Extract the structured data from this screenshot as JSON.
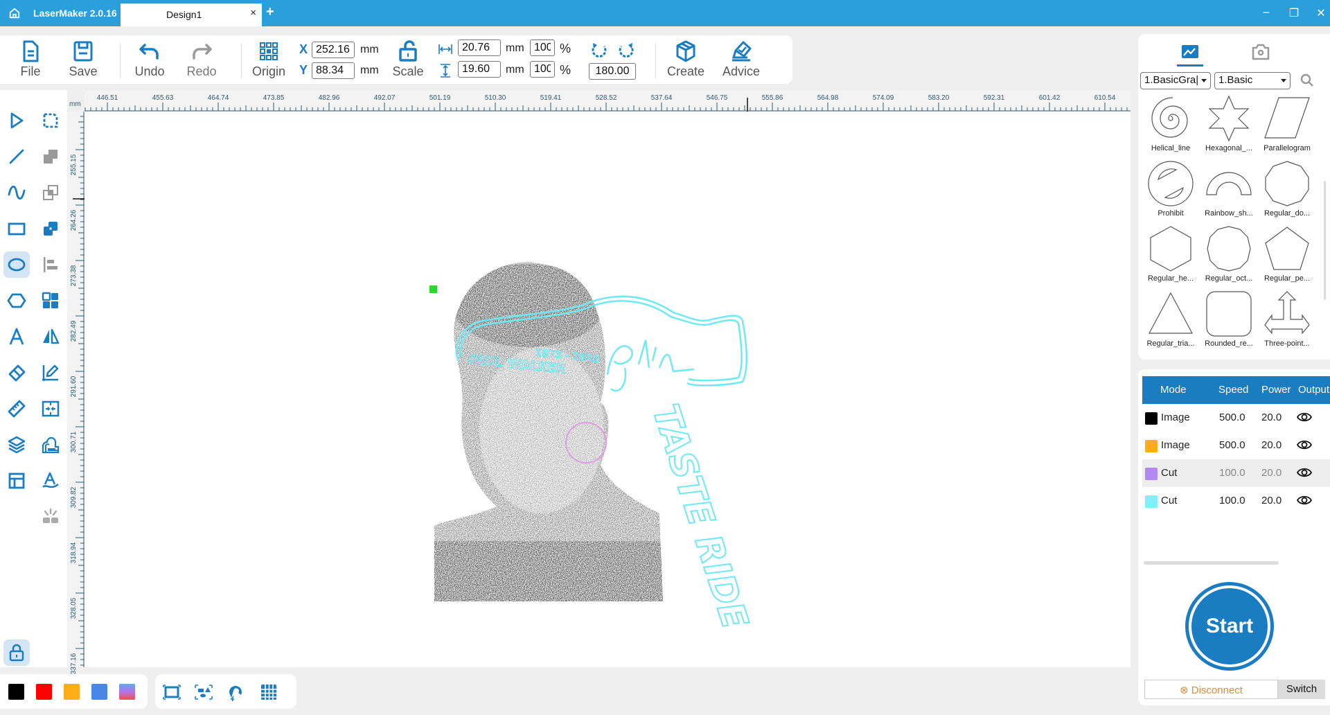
{
  "titlebar": {
    "app_name": "LaserMaker 2.0.16",
    "tab_name": "Design1",
    "tab_close": "×",
    "add_tab": "+",
    "minimize": "–",
    "restore": "❐",
    "close": "✕"
  },
  "toolbar": {
    "file": "File",
    "save": "Save",
    "undo": "Undo",
    "redo": "Redo",
    "origin": "Origin",
    "x_label": "X",
    "y_label": "Y",
    "x_value": "252.16",
    "y_value": "88.34",
    "unit": "mm",
    "scale": "Scale",
    "width_value": "20.76",
    "height_value": "19.60",
    "width_pct": "100",
    "height_pct": "100",
    "pct": "%",
    "rotation_value": "180.00",
    "create": "Create",
    "advice": "Advice"
  },
  "ruler": {
    "unit": "mm",
    "top_ticks": [
      "446.51",
      "455.63",
      "464.74",
      "473.85",
      "482.96",
      "492.07",
      "501.19",
      "510.30",
      "519.41",
      "528.52",
      "537.64",
      "546.75",
      "555.86",
      "564.98",
      "574.09",
      "583.20",
      "592.31",
      "601.42",
      "610.54"
    ],
    "left_ticks": [
      "255.15",
      "264.26",
      "273.38",
      "282.49",
      "291.60",
      "300.71",
      "309.82",
      "318.94",
      "328.05",
      "337.16"
    ]
  },
  "left_tools": [
    {
      "name": "select-tool",
      "icon": "pointer-icon"
    },
    {
      "name": "node-edit-tool",
      "icon": "node-edit-icon"
    },
    {
      "name": "line-tool",
      "icon": "line-icon"
    },
    {
      "name": "union-tool",
      "icon": "union-icon"
    },
    {
      "name": "curve-tool",
      "icon": "curve-icon"
    },
    {
      "name": "subtract-tool",
      "icon": "subtract-icon"
    },
    {
      "name": "rectangle-tool",
      "icon": "rectangle-icon"
    },
    {
      "name": "intersect-tool",
      "icon": "intersect-icon"
    },
    {
      "name": "ellipse-tool",
      "icon": "ellipse-icon",
      "active": true
    },
    {
      "name": "align-tool",
      "icon": "align-icon"
    },
    {
      "name": "polygon-tool",
      "icon": "hexagon-icon"
    },
    {
      "name": "array-tool",
      "icon": "grid-icon"
    },
    {
      "name": "text-tool",
      "icon": "text-icon"
    },
    {
      "name": "mirror-tool",
      "icon": "mirror-icon"
    },
    {
      "name": "eraser-tool",
      "icon": "eraser-icon"
    },
    {
      "name": "measure-edit-tool",
      "icon": "pen-edit-icon"
    },
    {
      "name": "ruler-tool",
      "icon": "ruler-icon"
    },
    {
      "name": "fit-tool",
      "icon": "fit-icon"
    },
    {
      "name": "layers-tool",
      "icon": "layers-icon"
    },
    {
      "name": "offset-tool",
      "icon": "offset-icon"
    },
    {
      "name": "layout-tool",
      "icon": "layout-icon"
    },
    {
      "name": "path-text-tool",
      "icon": "path-text-icon"
    },
    {
      "name": "laser-tool",
      "icon": "laser-icon"
    }
  ],
  "colors": {
    "accent": "#1a7dc2",
    "titlebar": "#2a9fdc",
    "cyan_cut": "#6ee9f5",
    "swatches": [
      "#000000",
      "#ff0000",
      "#ffab1a",
      "#4a86e8",
      "gradient"
    ]
  },
  "right_panel": {
    "tabs": [
      {
        "name": "gallery-tab",
        "icon": "image-icon",
        "active": true
      },
      {
        "name": "camera-tab",
        "icon": "camera-icon",
        "active": false
      }
    ],
    "category_select": "1.BasicGra|",
    "subcategory_select": "1.Basic",
    "shapes": [
      "Helical_line",
      "Hexagonal_...",
      "Parallelogram",
      "Prohibit",
      "Rainbow_sh...",
      "Regular_do...",
      "Regular_he...",
      "Regular_oct...",
      "Regular_pe...",
      "Regular_tria...",
      "Rounded_re...",
      "Three-point..."
    ]
  },
  "layers": {
    "headers": [
      "Mode",
      "Speed",
      "Power",
      "Output"
    ],
    "rows": [
      {
        "color": "#000000",
        "mode": "Image",
        "speed": "500.0",
        "power": "20.0",
        "visible": true
      },
      {
        "color": "#ffab1a",
        "mode": "Image",
        "speed": "500.0",
        "power": "20.0",
        "visible": true
      },
      {
        "color": "#b388f5",
        "mode": "Cut",
        "speed": "100.0",
        "power": "20.0",
        "visible": true,
        "selected": true
      },
      {
        "color": "#7ff0f8",
        "mode": "Cut",
        "speed": "100.0",
        "power": "20.0",
        "visible": true
      }
    ]
  },
  "actions": {
    "start": "Start",
    "disconnect": "Disconnect",
    "switch": "Switch"
  },
  "canvas_art": {
    "text_years": "1973 - 2013",
    "text_name": "PAUL WALKER",
    "text_vertical": "TASTE RIDE"
  }
}
